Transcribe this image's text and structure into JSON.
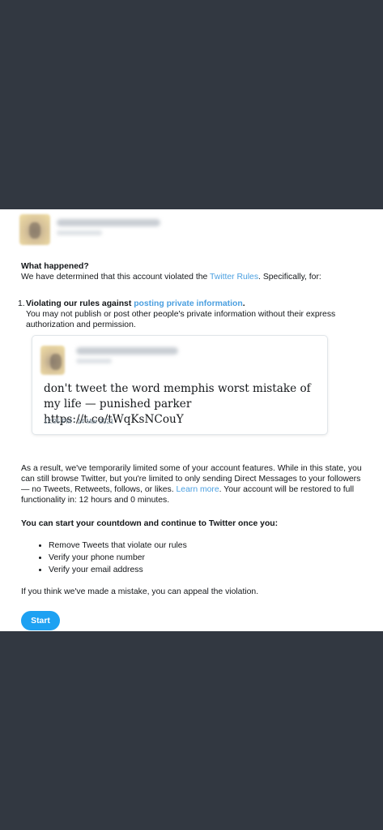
{
  "notice": {
    "heading": "What happened?",
    "intro_prefix": "We have determined that this account violated the ",
    "intro_link": "Twitter Rules",
    "intro_suffix": ". Specifically, for:"
  },
  "violation": {
    "number": "1.",
    "title_prefix": "Violating our rules against ",
    "title_link": "posting private information",
    "title_suffix": ".",
    "description": "You may not publish or post other people's private information without their express authorization and permission."
  },
  "tweet": {
    "text": "don't tweet the word memphis worst mistake of my life — punished parker https://t.co/tWqKsNCouY",
    "timestamp": "12:05 PM - 14 Mar 2021"
  },
  "result": {
    "text_prefix": "As a result, we've temporarily limited some of your account features. While in this state, you can still browse Twitter, but you're limited to only sending Direct Messages to your followers — no Tweets, Retweets, follows, or likes. ",
    "learn_more": "Learn more",
    "text_suffix": ". Your account will be restored to full functionality in: 12 hours and 0 minutes."
  },
  "countdown": {
    "heading": "You can start your countdown and continue to Twitter once you:",
    "items": [
      "Remove Tweets that violate our rules",
      "Verify your phone number",
      "Verify your email address"
    ]
  },
  "appeal_text": "If you think we've made a mistake, you can appeal the violation.",
  "start_label": "Start",
  "colors": {
    "backdrop": "#323841",
    "link": "#4a9fe0",
    "button": "#1da1f2"
  }
}
